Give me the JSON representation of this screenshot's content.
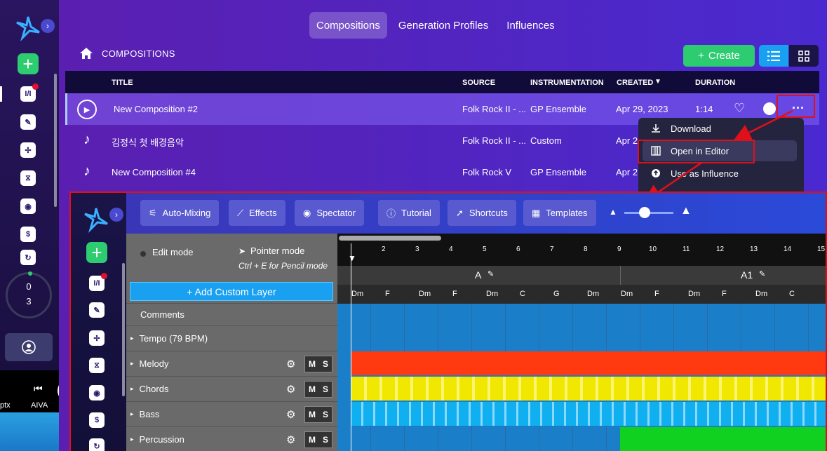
{
  "nav": {
    "tabs": [
      "Compositions",
      "Generation Profiles",
      "Influences"
    ],
    "active": 0
  },
  "page": {
    "title": "COMPOSITIONS"
  },
  "actions": {
    "create_label": "Create"
  },
  "table": {
    "headers": {
      "title": "TITLE",
      "source": "SOURCE",
      "instrumentation": "INSTRUMENTATION",
      "created": "CREATED",
      "duration": "DURATION"
    },
    "rows": [
      {
        "title": "New Composition #2",
        "source": "Folk Rock II - ...",
        "instrumentation": "GP Ensemble",
        "created": "Apr 29, 2023",
        "duration": "1:14"
      },
      {
        "title": "김정식 첫 배경음악",
        "source": "Folk Rock II - ...",
        "instrumentation": "Custom",
        "created": "Apr 2"
      },
      {
        "title": "New Composition #4",
        "source": "Folk Rock V",
        "instrumentation": "GP Ensemble",
        "created": "Apr 2"
      }
    ]
  },
  "context_menu": {
    "items": [
      "Download",
      "Open in Editor",
      "Use as Influence"
    ],
    "highlighted": 1
  },
  "sidebar": {
    "counter_top": "0",
    "counter_bottom": "3"
  },
  "player": {
    "desk_labels": [
      "ptx",
      "AIVA"
    ]
  },
  "editor": {
    "toolbar": [
      "Auto-Mixing",
      "Effects",
      "Spectator",
      "Tutorial",
      "Shortcuts",
      "Templates"
    ],
    "modes": {
      "edit": "Edit mode",
      "pointer": "Pointer mode",
      "hint": "Ctrl + E for Pencil mode"
    },
    "add_layer_label": "+ Add Custom Layer",
    "layers": [
      "Comments",
      "Tempo (79 BPM)",
      "Melody",
      "Chords",
      "Bass",
      "Percussion"
    ],
    "mute_label": "M",
    "solo_label": "S",
    "ruler_numbers": [
      "2",
      "3",
      "4",
      "5",
      "6",
      "7",
      "8",
      "9",
      "10",
      "11",
      "12",
      "13",
      "14",
      "15"
    ],
    "sections": [
      "A",
      "A1"
    ],
    "chord_labels": [
      "Dm",
      "F",
      "Dm",
      "F",
      "Dm",
      "C",
      "G",
      "Dm",
      "Dm",
      "F",
      "Dm",
      "F",
      "Dm",
      "C"
    ],
    "track_colors": {
      "melody": "#ff3a10",
      "chords": "#f0e800",
      "bass": "#10b0f0",
      "percussion": "#10d020"
    }
  }
}
